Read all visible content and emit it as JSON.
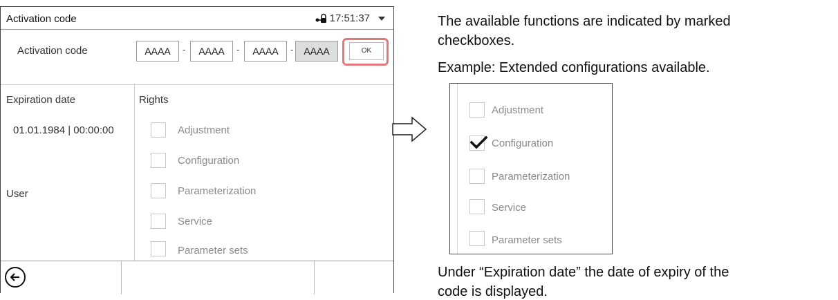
{
  "screen": {
    "title": "Activation code",
    "time": "17:51:37",
    "activation_label": "Activation code",
    "code_segments": [
      "AAAA",
      "AAAA",
      "AAAA",
      "AAAA"
    ],
    "code_separator": "-",
    "ok_label": "OK",
    "expiration_label": "Expiration date",
    "expiration_value": "01.01.1984 | 00:00:00",
    "user_label": "User",
    "rights_label": "Rights",
    "rights": [
      "Adjustment",
      "Configuration",
      "Parameterization",
      "Service",
      "Parameter sets"
    ]
  },
  "doc": {
    "line1": "The available functions are indicated by marked",
    "line2": "checkboxes.",
    "line3": "Example: Extended configurations available.",
    "example_items": [
      {
        "label": "Adjustment",
        "checked": false
      },
      {
        "label": "Configuration",
        "checked": true
      },
      {
        "label": "Parameterization",
        "checked": false
      },
      {
        "label": "Service",
        "checked": false
      },
      {
        "label": "Parameter sets",
        "checked": false
      }
    ],
    "line4": "Under “Expiration date” the date of expiry of the",
    "line5": "code is displayed."
  },
  "colors": {
    "highlight": "#e57778",
    "border": "#444444",
    "muted_text": "#8a8a8a"
  },
  "icons": [
    "padlock-key-icon",
    "dropdown-caret-icon",
    "back-arrow-icon",
    "right-arrow-icon",
    "checkmark-icon"
  ]
}
